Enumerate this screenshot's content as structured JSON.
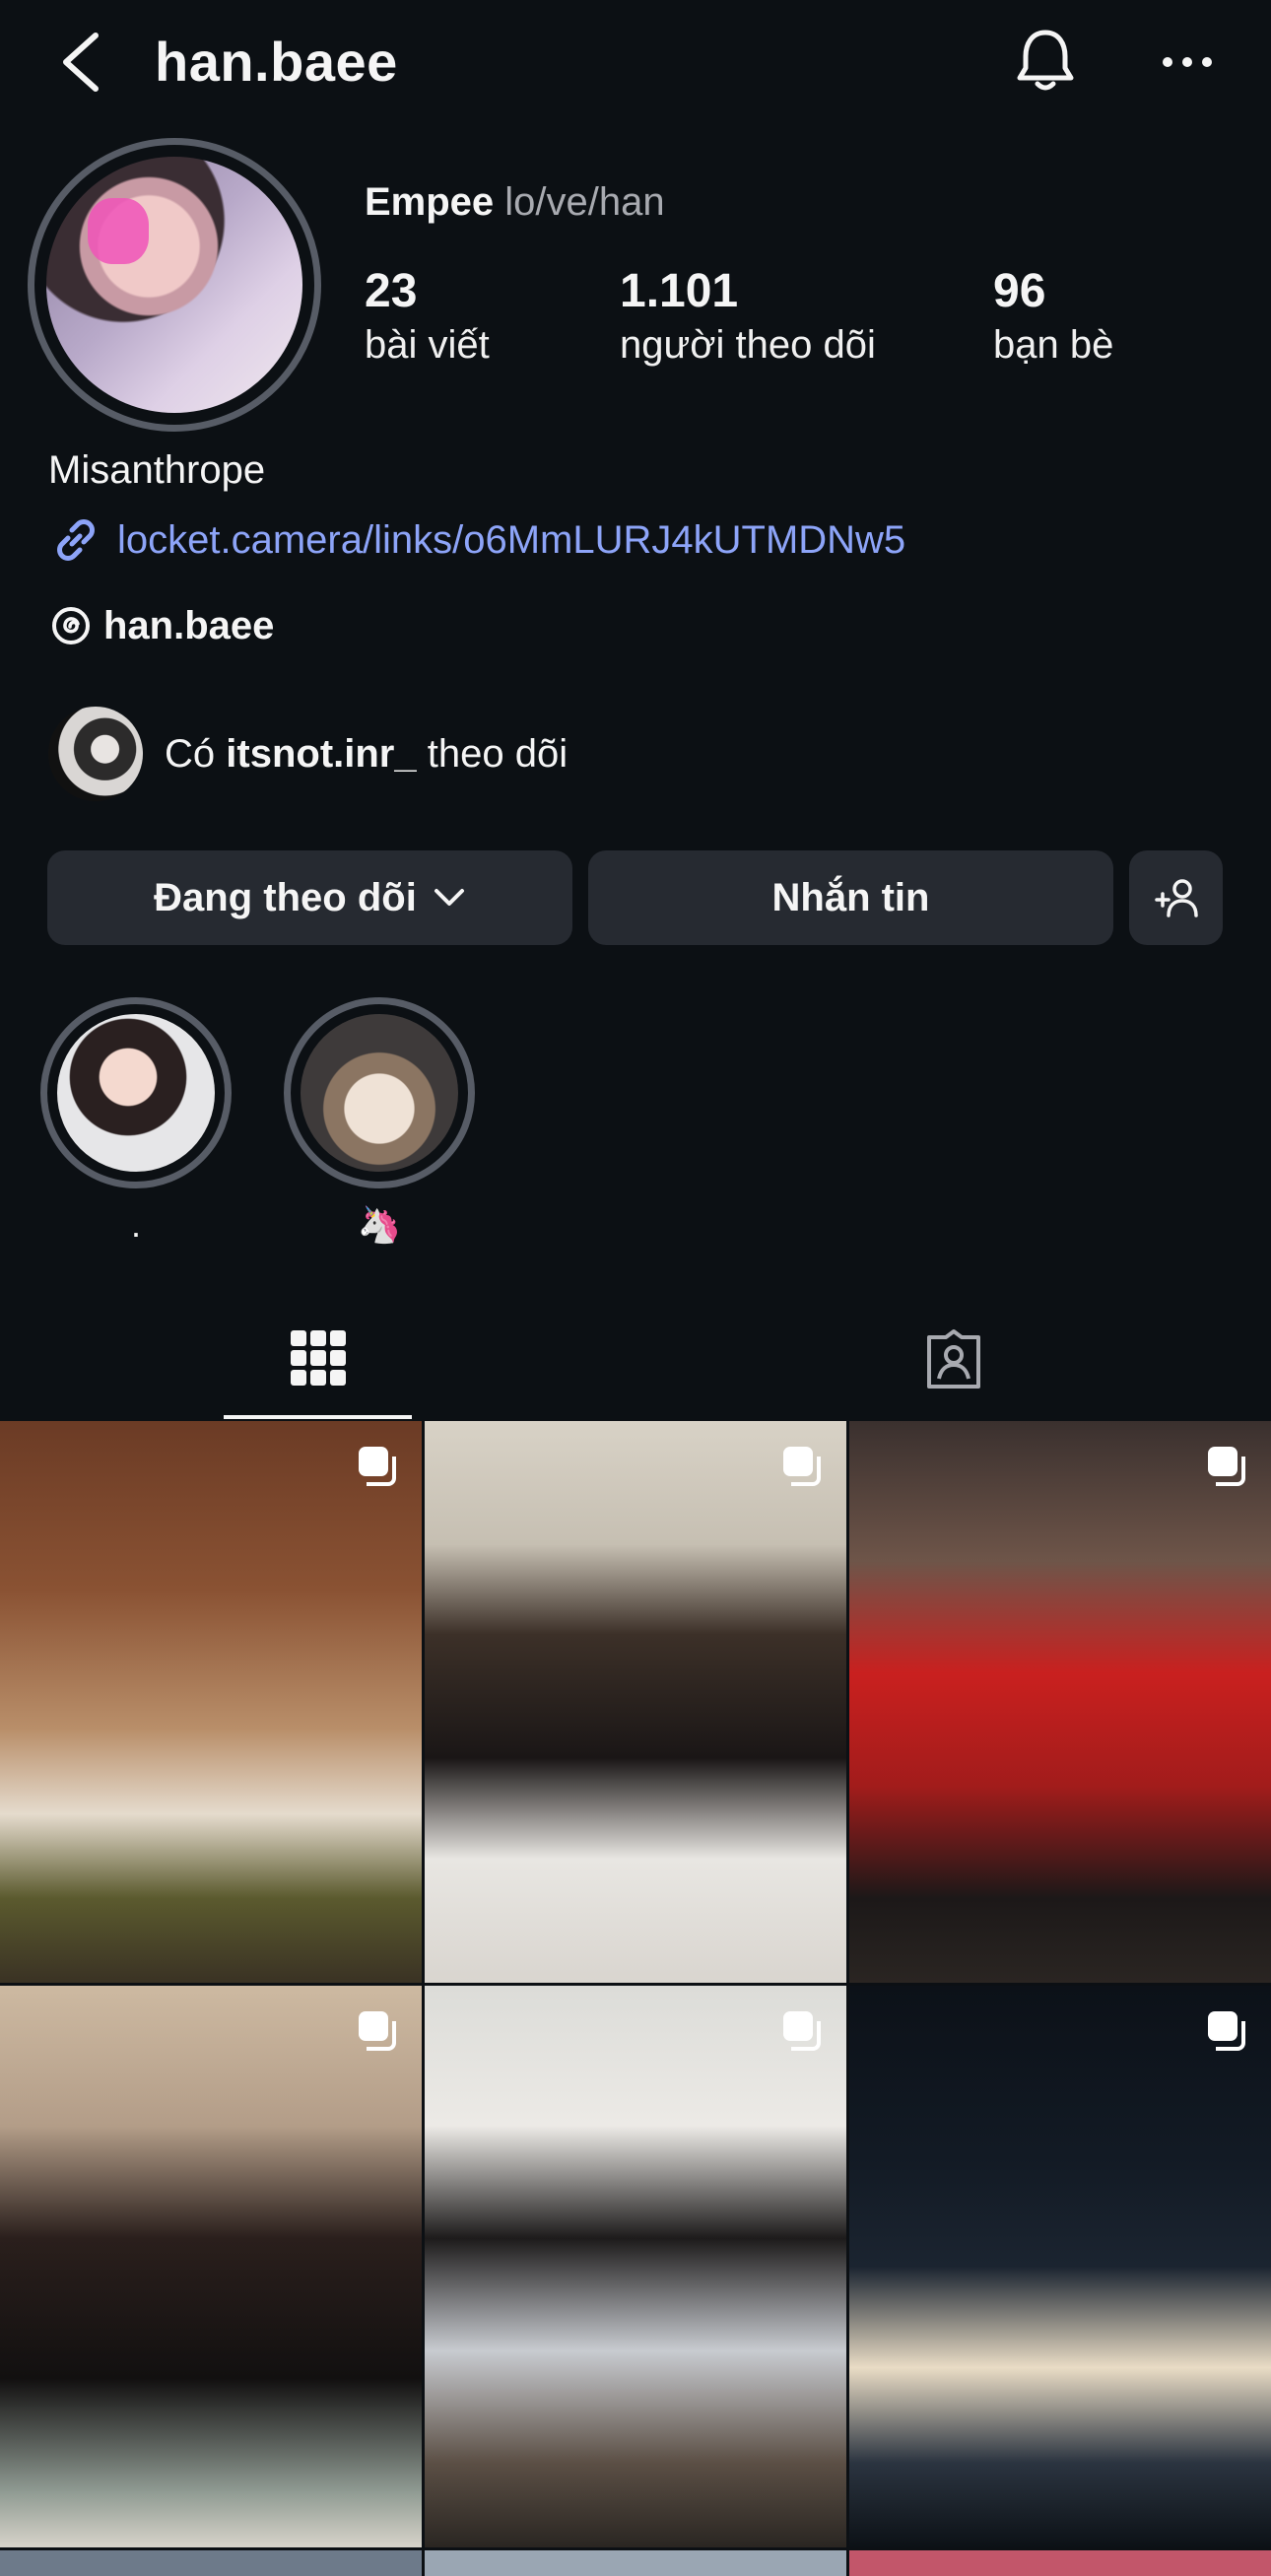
{
  "header": {
    "username": "han.baee",
    "icons": [
      "back-icon",
      "bell-icon",
      "more-icon"
    ]
  },
  "profile": {
    "display_name": "Empee",
    "pronouns": "lo/ve/han",
    "stats": [
      {
        "num": "23",
        "label": "bài viết"
      },
      {
        "num": "1.101",
        "label": "người theo dõi"
      },
      {
        "num": "96",
        "label": "bạn bè"
      }
    ],
    "bio": "Misanthrope",
    "link": "locket.camera/links/o6MmLURJ4kUTMDNw5",
    "threads": "han.baee",
    "mutual": {
      "prefix": "Có",
      "name": "itsnot.inr_",
      "suffix": "theo dõi"
    }
  },
  "actions": {
    "following": "Đang theo dõi",
    "message": "Nhắn tin"
  },
  "highlights": [
    {
      "caption": "."
    },
    {
      "caption": "🦄"
    }
  ],
  "tabs": [
    "grid-icon",
    "tagged-icon"
  ],
  "accent": {
    "link": "#8da4f8",
    "background": "#0c1014",
    "button": "#262a31"
  }
}
